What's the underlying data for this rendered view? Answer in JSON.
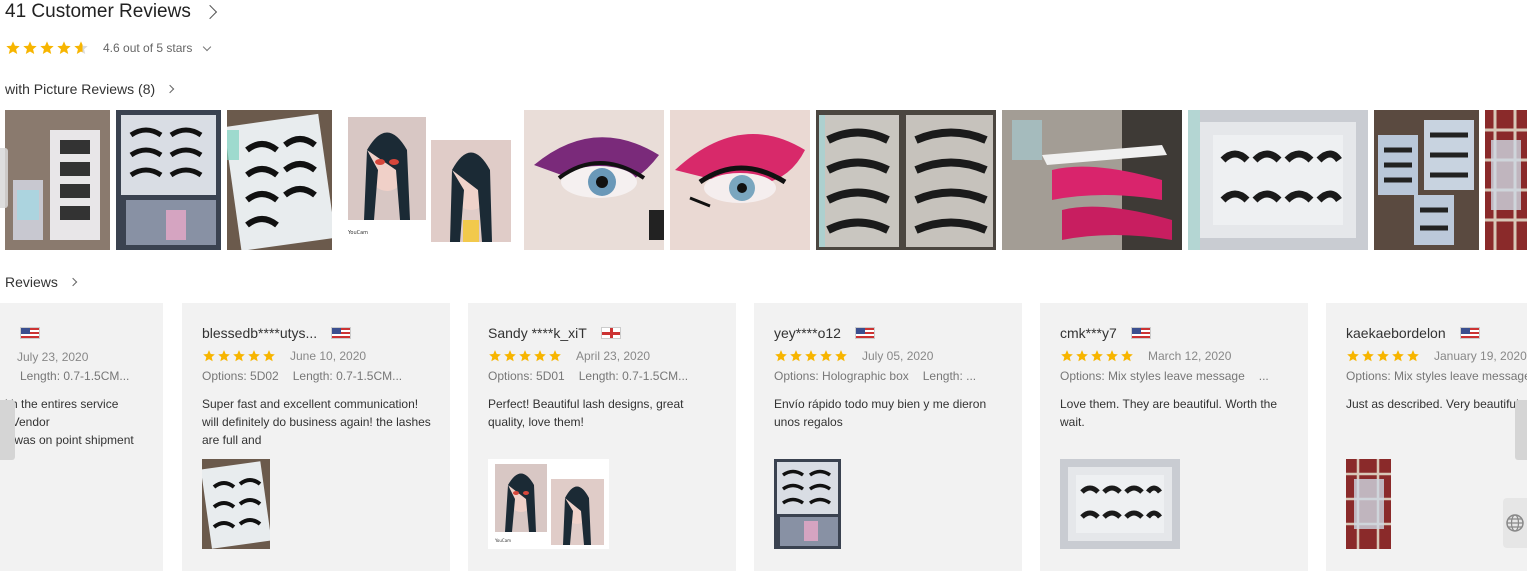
{
  "header": {
    "title": "41 Customer Reviews",
    "rating_text": "4.6 out of 5 stars",
    "rating": 4.6
  },
  "picture_reviews": {
    "label": "with Picture Reviews (8)",
    "thumbnails": [
      {
        "icon": "lash-boxes-photo"
      },
      {
        "icon": "lash-tray-photo"
      },
      {
        "icon": "lash-pairs-photo"
      },
      {
        "icon": "makeup-selfie-photo",
        "caption": "YouCam"
      },
      {
        "icon": "purple-eye-makeup-photo"
      },
      {
        "icon": "pink-eye-makeup-photo"
      },
      {
        "icon": "lash-cases-photo"
      },
      {
        "icon": "pink-tweezers-photo"
      },
      {
        "icon": "holographic-lash-box-photo"
      },
      {
        "icon": "lash-packs-photo"
      },
      {
        "icon": "plaid-lash-photo"
      }
    ]
  },
  "reviews_section": {
    "label": "Reviews"
  },
  "partial_review": {
    "date": "July 23, 2020",
    "option": "Length: 0.7-1.5CM...",
    "text_lines": [
      "ith the entires service",
      ": Vendor",
      "s was on point shipment"
    ]
  },
  "reviews": [
    {
      "user": "blessedb****utys...",
      "flag": "us",
      "stars": 5,
      "date": "June 10, 2020",
      "options": [
        "Options: 5D02",
        "Length: 0.7-1.5CM..."
      ],
      "text": "Super fast and excellent communication! will definitely do business again! the lashes are full and",
      "photo": "lash-pairs-photo"
    },
    {
      "user": "Sandy ****k_xiT",
      "flag": "uk",
      "stars": 5,
      "date": "April 23, 2020",
      "options": [
        "Options: 5D01",
        "Length: 0.7-1.5CM..."
      ],
      "text": "Perfect! Beautiful lash designs, great quality, love them!",
      "photo": "makeup-selfie-photo",
      "photo_caption": "YouCam"
    },
    {
      "user": "yey****o12",
      "flag": "us",
      "stars": 5,
      "date": "July 05, 2020",
      "options": [
        "Options: Holographic box",
        "Length: ..."
      ],
      "text": "Envío rápido todo muy bien y me dieron unos regalos",
      "photo": "lash-tray-photo"
    },
    {
      "user": "cmk***y7",
      "flag": "us",
      "stars": 5,
      "date": "March 12, 2020",
      "options": [
        "Options: Mix styles leave message",
        "..."
      ],
      "text": "Love them. They are beautiful. Worth the wait.",
      "photo": "holographic-lash-box-photo"
    },
    {
      "user": "kaekaebordelon",
      "flag": "us",
      "stars": 5,
      "date": "January 19, 2020",
      "options": [
        "Options: Mix styles leave message",
        ""
      ],
      "text": "Just as described. Very beautiful",
      "photo": "plaid-lash-photo"
    }
  ],
  "colors": {
    "star": "#f7b500",
    "card_bg": "#f2f2f2",
    "text": "#333333"
  }
}
